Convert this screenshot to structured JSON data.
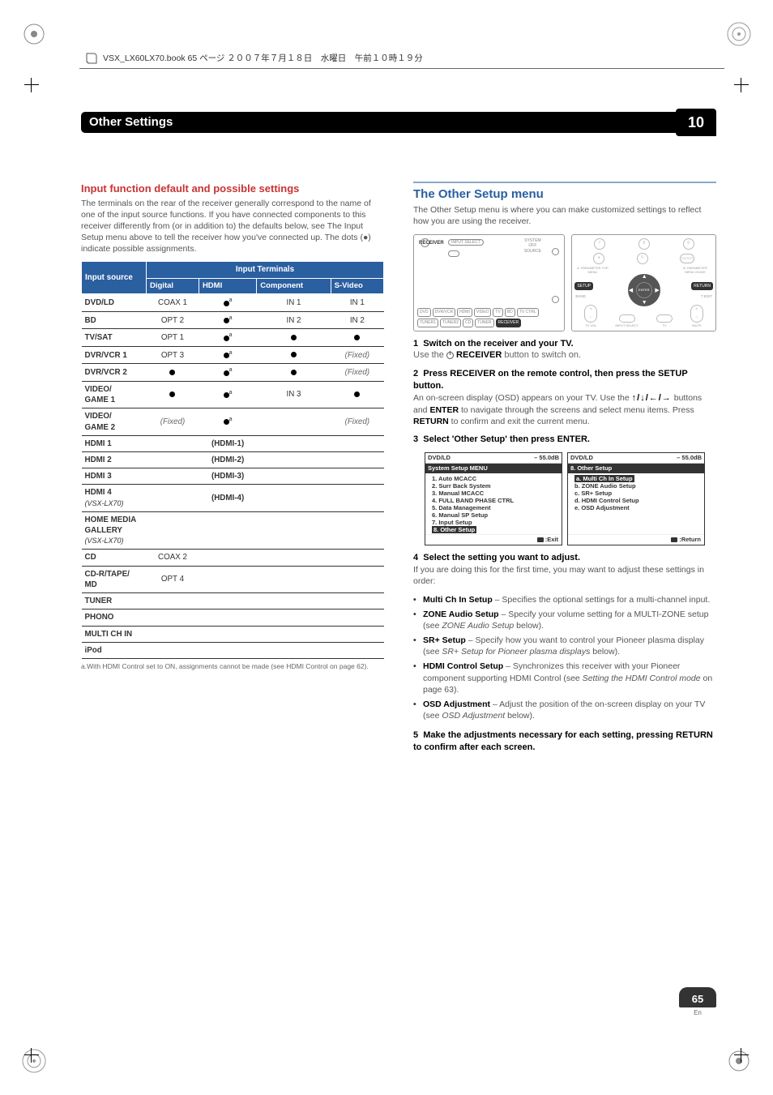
{
  "bookLine": "VSX_LX60LX70.book  65 ページ  ２００７年７月１８日　水曜日　午前１０時１９分",
  "chapterTitle": "Other Settings",
  "chapterNumber": "10",
  "leftHeading": "Input function default and possible settings",
  "leftIntro": "The terminals on the rear of the receiver generally correspond to the name of one of the input source functions. If you have connected components to this receiver differently from (or in addition to) the defaults below, see The Input Setup menu above to tell the receiver how you've connected up. The dots (●) indicate possible assignments.",
  "table": {
    "head1": {
      "source": "Input source",
      "terms": "Input Terminals"
    },
    "head2": [
      "Digital",
      "HDMI",
      "Component",
      "S-Video"
    ],
    "rows": [
      {
        "src": "DVD/LD",
        "c": [
          "COAX 1",
          "dot-a",
          "IN 1",
          "IN 1"
        ]
      },
      {
        "src": "BD",
        "c": [
          "OPT 2",
          "dot-a",
          "IN 2",
          "IN 2"
        ]
      },
      {
        "src": "TV/SAT",
        "c": [
          "OPT 1",
          "dot-a",
          "dot",
          "dot"
        ]
      },
      {
        "src": "DVR/VCR 1",
        "c": [
          "OPT 3",
          "dot-a",
          "dot",
          "(Fixed)"
        ]
      },
      {
        "src": "DVR/VCR 2",
        "c": [
          "dot",
          "dot-a",
          "dot",
          "(Fixed)"
        ]
      },
      {
        "src": "VIDEO/\nGAME 1",
        "c": [
          "dot",
          "dot-a",
          "IN 3",
          "dot"
        ]
      },
      {
        "src": "VIDEO/\nGAME 2",
        "c": [
          "(Fixed)",
          "dot-a",
          "",
          "(Fixed)"
        ]
      },
      {
        "src": "HDMI 1",
        "span": "(HDMI-1)"
      },
      {
        "src": "HDMI 2",
        "span": "(HDMI-2)"
      },
      {
        "src": "HDMI 3",
        "span": "(HDMI-3)"
      },
      {
        "src": "HDMI 4",
        "sub": "(VSX-LX70)",
        "span": "(HDMI-4)"
      },
      {
        "src": "HOME MEDIA GALLERY",
        "sub": "(VSX-LX70)",
        "c": [
          "",
          "",
          "",
          ""
        ]
      },
      {
        "src": "CD",
        "c": [
          "COAX 2",
          "",
          "",
          ""
        ]
      },
      {
        "src": "CD-R/TAPE/\nMD",
        "c": [
          "OPT 4",
          "",
          "",
          ""
        ]
      },
      {
        "src": "TUNER",
        "c": [
          "",
          "",
          "",
          ""
        ]
      },
      {
        "src": "PHONO",
        "c": [
          "",
          "",
          "",
          ""
        ]
      },
      {
        "src": "MULTI CH IN",
        "c": [
          "",
          "",
          "",
          ""
        ]
      },
      {
        "src": "iPod",
        "c": [
          "",
          "",
          "",
          ""
        ]
      }
    ],
    "footnote": "a.With HDMI Control set to ON, assignments cannot be made (see HDMI Control on page 62)."
  },
  "rightHeading": "The Other Setup menu",
  "rightIntro": "The Other Setup menu is where you can make customized settings to reflect how you are using the receiver.",
  "remoteLabels": {
    "receiver": "RECEIVER",
    "input": "INPUT SELECT",
    "system": "SYSTEM OFF SOURCE",
    "btns": [
      "DVD",
      "DVR/VCR",
      "HDMI",
      "VIDEO",
      "TV",
      "BD",
      "TV CTRL",
      "TUNER1",
      "TUNER2",
      "CD",
      "TUNER",
      "RECEIVER"
    ],
    "setup": "SETUP",
    "enter": "ENTER",
    "return": "RETURN",
    "side": [
      "A. PARAMETER TOP MENU",
      "B. PARAMETER MENU GUIDE",
      "BAND",
      "T.EDIT"
    ],
    "strip": [
      "TV VOL",
      "INPUT SELECT",
      "TV",
      "MUTE"
    ]
  },
  "steps": {
    "s1": {
      "n": "1",
      "t": "Switch on the receiver and your TV.",
      "sub": "Use the "
    },
    "s1b": " RECEIVER",
    "s1c": " button to switch on.",
    "s2": {
      "n": "2",
      "t": "Press RECEIVER on the remote control, then press the SETUP button."
    },
    "s2p": "An on-screen display (OSD) appears on your TV. Use the ",
    "s2arrows": "↑/↓/←/→",
    "s2p2": " buttons and ",
    "s2enter": "ENTER",
    "s2p3": " to navigate through the screens and select menu items. Press ",
    "s2return": "RETURN",
    "s2p4": " to confirm and exit the current menu.",
    "s3": {
      "n": "3",
      "t": "Select 'Other Setup' then press ENTER."
    }
  },
  "osd": {
    "level": "– 55.0dB",
    "src": "DVD/LD",
    "title1": "System Setup MENU",
    "list1": [
      "1. Auto MCACC",
      "2. Surr Back System",
      "3. Manual MCACC",
      "4. FULL BAND PHASE CTRL",
      "5. Data Management",
      "6. Manual SP Setup",
      "7. Input Setup",
      "8. Other Setup"
    ],
    "exit": ":Exit",
    "title2": "8. Other Setup",
    "list2": [
      "a. Multi Ch In Setup",
      "b. ZONE Audio Setup",
      "c. SR+ Setup",
      "d. HDMI Control Setup",
      "e. OSD Adjustment"
    ],
    "return": ":Return"
  },
  "step4": {
    "n": "4",
    "t": "Select the setting you want to adjust."
  },
  "step4p": "If you are doing this for the first time, you may want to adjust these settings in order:",
  "bullets": [
    {
      "b": "Multi Ch In Setup",
      "t": " – Specifies the optional settings for a multi-channel input."
    },
    {
      "b": "ZONE Audio Setup",
      "t": " – Specify your volume setting for a MULTI-ZONE setup (see ",
      "i": "ZONE Audio Setup",
      "t2": " below)."
    },
    {
      "b": "SR+ Setup",
      "t": " – Specify how you want to control your Pioneer plasma display (see ",
      "i": "SR+ Setup for Pioneer plasma displays",
      "t2": " below)."
    },
    {
      "b": "HDMI Control Setup",
      "t": " – Synchronizes this receiver with your Pioneer component supporting HDMI Control (see ",
      "i": "Setting the HDMI Control mode",
      "t2": " on page 63)."
    },
    {
      "b": "OSD Adjustment",
      "t": " – Adjust the position of the on-screen display on your TV (see ",
      "i": "OSD Adjustment",
      "t2": " below)."
    }
  ],
  "step5": {
    "n": "5",
    "t": "Make the adjustments necessary for each setting, pressing RETURN to confirm after each screen."
  },
  "pageNum": "65",
  "pageLang": "En"
}
